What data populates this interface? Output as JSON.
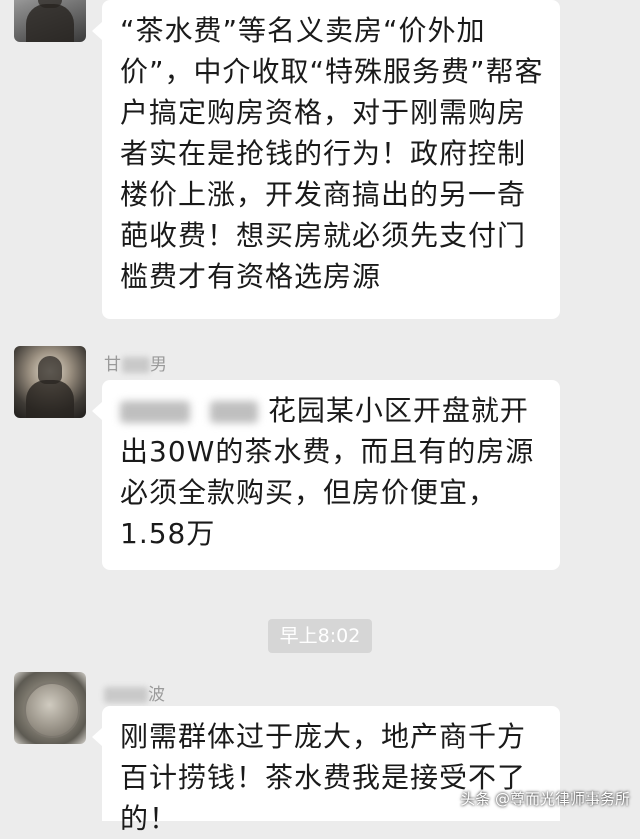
{
  "messages": [
    {
      "avatar_icon": "man-avatar-icon",
      "name": "",
      "text": "“茶水费”等名义卖房“价外加价”，中介收取“特殊服务费”帮客户搞定购房资格，对于刚需购房者实在是抢钱的行为！政府控制楼价上涨，开发商搞出的另一奇葩收费！想买房就必须先支付门槛费才有资格选房源"
    },
    {
      "avatar_icon": "armored-man-avatar-icon",
      "name_visible": "甘",
      "name_suffix": "男",
      "text_after_redaction": "花园某小区开盘就开出30W的茶水费，而且有的房源必须全款购买，但房价便宜，1.58万"
    },
    {
      "avatar_icon": "coin-avatar-icon",
      "name_suffix": "波",
      "text": "刚需群体过于庞大，地产商千方百计捞钱！茶水费我是接受不了的！"
    }
  ],
  "timestamp": "早上8:02",
  "watermark": "头条 @尊而光律师事务所"
}
